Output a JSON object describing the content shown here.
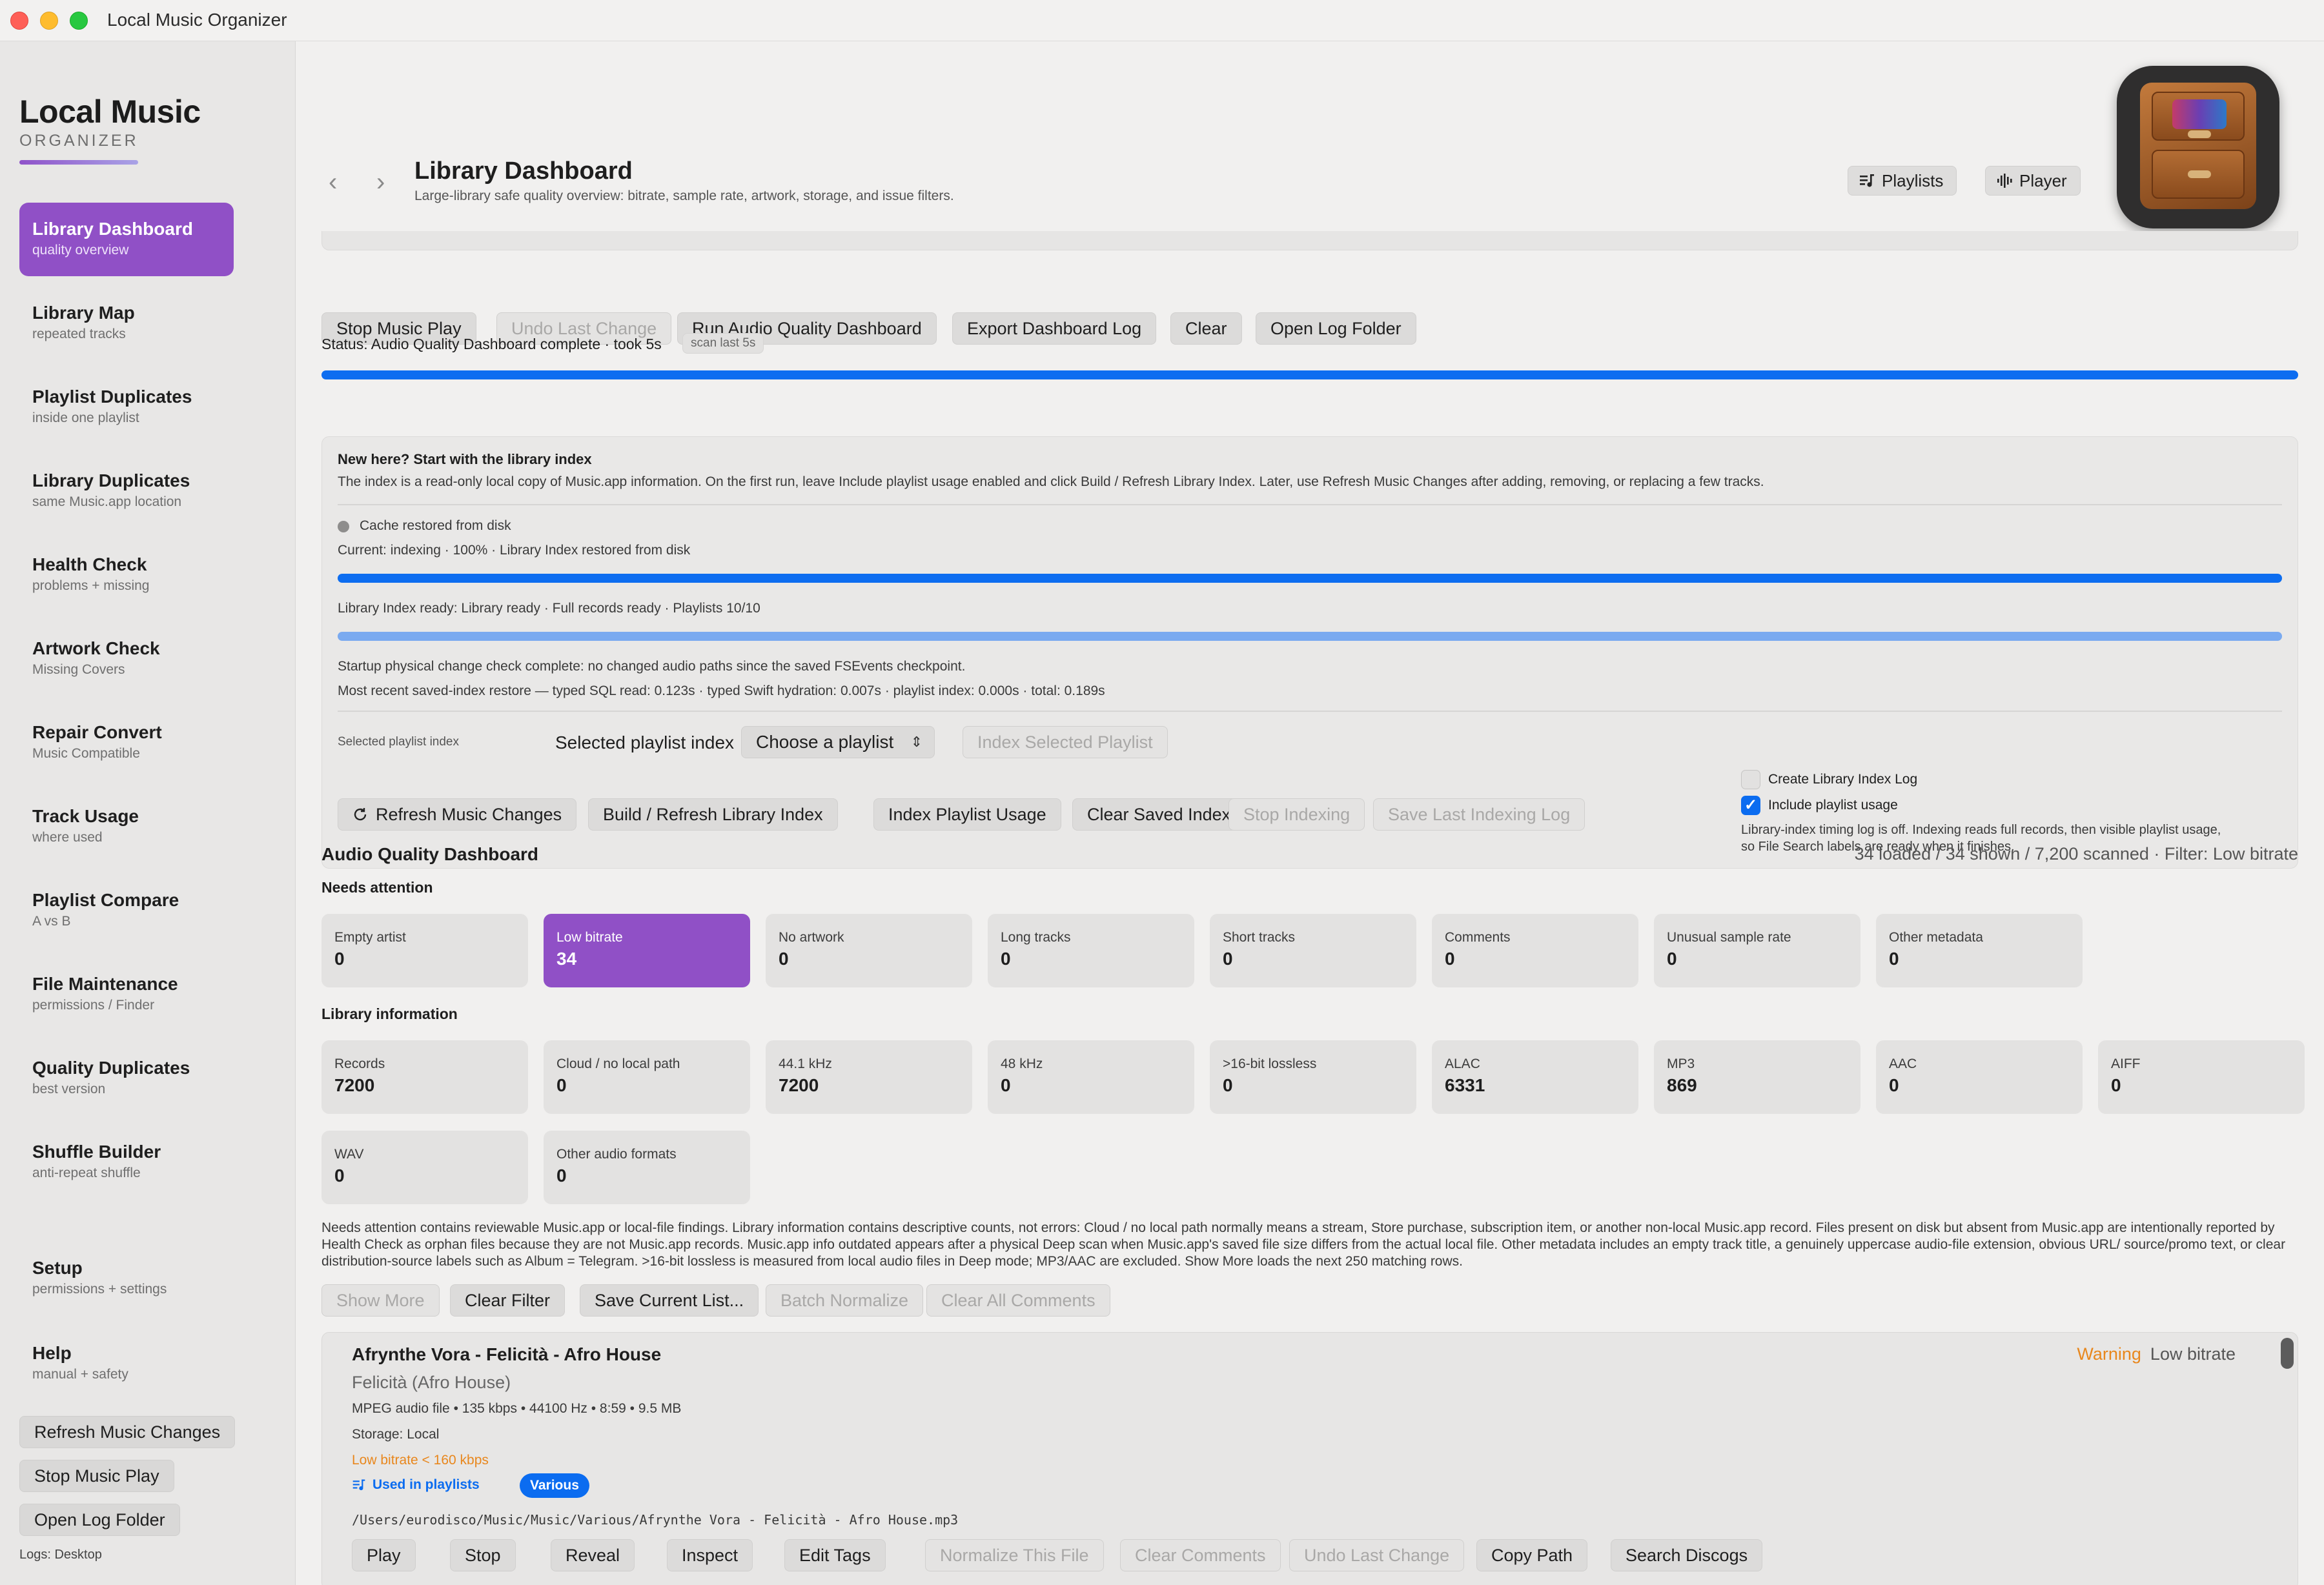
{
  "window": {
    "title": "Local Music Organizer"
  },
  "brand": {
    "title": "Local Music",
    "subtitle": "ORGANIZER"
  },
  "sidebar": {
    "items": [
      {
        "label": "Library Dashboard",
        "sub": "quality overview"
      },
      {
        "label": "Library Map",
        "sub": "repeated tracks"
      },
      {
        "label": "Playlist Duplicates",
        "sub": "inside one playlist"
      },
      {
        "label": "Library Duplicates",
        "sub": "same Music.app location"
      },
      {
        "label": "Health Check",
        "sub": "problems + missing"
      },
      {
        "label": "Artwork Check",
        "sub": "Missing Covers"
      },
      {
        "label": "Repair Convert",
        "sub": "Music Compatible"
      },
      {
        "label": "Track Usage",
        "sub": "where used"
      },
      {
        "label": "Playlist Compare",
        "sub": "A vs B"
      },
      {
        "label": "File Maintenance",
        "sub": "permissions / Finder"
      },
      {
        "label": "Quality Duplicates",
        "sub": "best version"
      },
      {
        "label": "Shuffle Builder",
        "sub": "anti-repeat shuffle"
      }
    ],
    "setup": {
      "label": "Setup",
      "sub": "permissions + settings"
    },
    "help": {
      "label": "Help",
      "sub": "manual + safety"
    },
    "buttons": {
      "refresh": "Refresh Music Changes",
      "stop": "Stop Music Play",
      "open_log": "Open Log Folder"
    },
    "logs": "Logs: Desktop"
  },
  "header": {
    "title": "Library Dashboard",
    "subtitle": "Large-library safe quality overview: bitrate, sample rate, artwork, storage, and issue filters.",
    "playlists_btn": "Playlists",
    "player_btn": "Player"
  },
  "toolbar": {
    "stop": "Stop Music Play",
    "undo": "Undo Last Change",
    "run": "Run Audio Quality Dashboard",
    "export": "Export Dashboard Log",
    "clear": "Clear",
    "open_log": "Open Log Folder"
  },
  "status": {
    "text": "Status: Audio Quality Dashboard complete · took 5s",
    "pill": "scan last 5s"
  },
  "index": {
    "heading": "New here? Start with the library index",
    "intro": "The index is a read-only local copy of Music.app information. On the first run, leave Include playlist usage enabled and click Build / Refresh Library Index. Later, use Refresh Music Changes after adding, removing, or replacing a few tracks.",
    "cache": "Cache restored from disk",
    "current": "Current: indexing · 100% · Library Index restored from disk",
    "ready": "Library Index ready: Library ready · Full records ready · Playlists 10/10",
    "startup": "Startup physical change check complete: no changed audio paths since the saved FSEvents checkpoint.",
    "restore": "Most recent saved-index restore — typed SQL read: 0.123s · typed Swift hydration: 0.007s · playlist index: 0.000s · total: 0.189s",
    "sel_label_small": "Selected playlist index",
    "sel_label": "Selected playlist index",
    "select_value": "Choose a playlist",
    "index_selected": "Index Selected Playlist",
    "create_log": "Create Library Index Log",
    "include_usage": "Include playlist usage",
    "note_1": "Library-index timing log is off. Indexing reads full records, then visible playlist usage,",
    "note_2": "so File Search labels are ready when it finishes.",
    "buttons": {
      "refresh": "Refresh Music Changes",
      "build": "Build / Refresh Library Index",
      "playlist_usage": "Index Playlist Usage",
      "clear_saved": "Clear Saved Index",
      "stop": "Stop Indexing",
      "save_log": "Save Last Indexing Log"
    }
  },
  "dashboard": {
    "title": "Audio Quality Dashboard",
    "summary": "34 loaded / 34 shown / 7,200 scanned · Filter: Low bitrate",
    "needs_attention": "Needs attention",
    "library_info": "Library information",
    "attention_cards": [
      {
        "label": "Empty artist",
        "value": "0"
      },
      {
        "label": "Low bitrate",
        "value": "34"
      },
      {
        "label": "No artwork",
        "value": "0"
      },
      {
        "label": "Long tracks",
        "value": "0"
      },
      {
        "label": "Short tracks",
        "value": "0"
      },
      {
        "label": "Comments",
        "value": "0"
      },
      {
        "label": "Unusual sample rate",
        "value": "0"
      },
      {
        "label": "Other metadata",
        "value": "0"
      }
    ],
    "info_cards": [
      {
        "label": "Records",
        "value": "7200"
      },
      {
        "label": "Cloud / no local path",
        "value": "0"
      },
      {
        "label": "44.1 kHz",
        "value": "7200"
      },
      {
        "label": "48 kHz",
        "value": "0"
      },
      {
        "label": ">16-bit lossless",
        "value": "0"
      },
      {
        "label": "ALAC",
        "value": "6331"
      },
      {
        "label": "MP3",
        "value": "869"
      },
      {
        "label": "AAC",
        "value": "0"
      },
      {
        "label": "AIFF",
        "value": "0"
      },
      {
        "label": "WAV",
        "value": "0"
      },
      {
        "label": "Other audio formats",
        "value": "0"
      }
    ],
    "description": "Needs attention contains reviewable Music.app or local-file findings. Library information contains descriptive counts, not errors: Cloud / no local path normally means a stream, Store purchase, subscription item, or another non-local Music.app record. Files present on disk but absent from Music.app are intentionally reported by Health Check as orphan files because they are not Music.app records. Music.app info outdated appears after a physical Deep scan when Music.app's saved file size differs from the actual local file. Other metadata includes an empty track title, a genuinely uppercase audio-file extension, obvious URL/ source/promo text, or clear distribution-source labels such as Album = Telegram. >16-bit lossless is measured from local audio files in Deep mode; MP3/AAC are excluded. Show More loads the next 250 matching rows.",
    "actions": {
      "show_more": "Show More",
      "clear_filter": "Clear Filter",
      "save_list": "Save Current List...",
      "batch_normalize": "Batch Normalize",
      "clear_comments": "Clear All Comments"
    }
  },
  "track": {
    "title": "Afrynthe Vora - Felicità - Afro House",
    "warning": "Warning",
    "filter": "Low bitrate",
    "subtitle": "Felicità (Afro House)",
    "meta": "MPEG audio file • 135 kbps • 44100 Hz • 8:59 • 9.5 MB",
    "storage": "Storage: Local",
    "issue": "Low bitrate < 160 kbps",
    "used": "Used in playlists",
    "used_pill": "Various",
    "path": "/Users/eurodisco/Music/Music/Various/Afrynthe Vora - Felicità - Afro House.mp3",
    "buttons": {
      "play": "Play",
      "stop": "Stop",
      "reveal": "Reveal",
      "inspect": "Inspect",
      "edit_tags": "Edit Tags",
      "normalize": "Normalize This File",
      "clear_comments": "Clear Comments",
      "undo": "Undo Last Change",
      "copy_path": "Copy Path",
      "search_discogs": "Search Discogs"
    }
  },
  "colors": {
    "accent": "#9050c6",
    "progress": "#0d6df0",
    "warning": "#e8871d"
  },
  "progress": {
    "status_bar": 1.0,
    "index_bar": 1.0,
    "ready_bar": 1.0
  }
}
